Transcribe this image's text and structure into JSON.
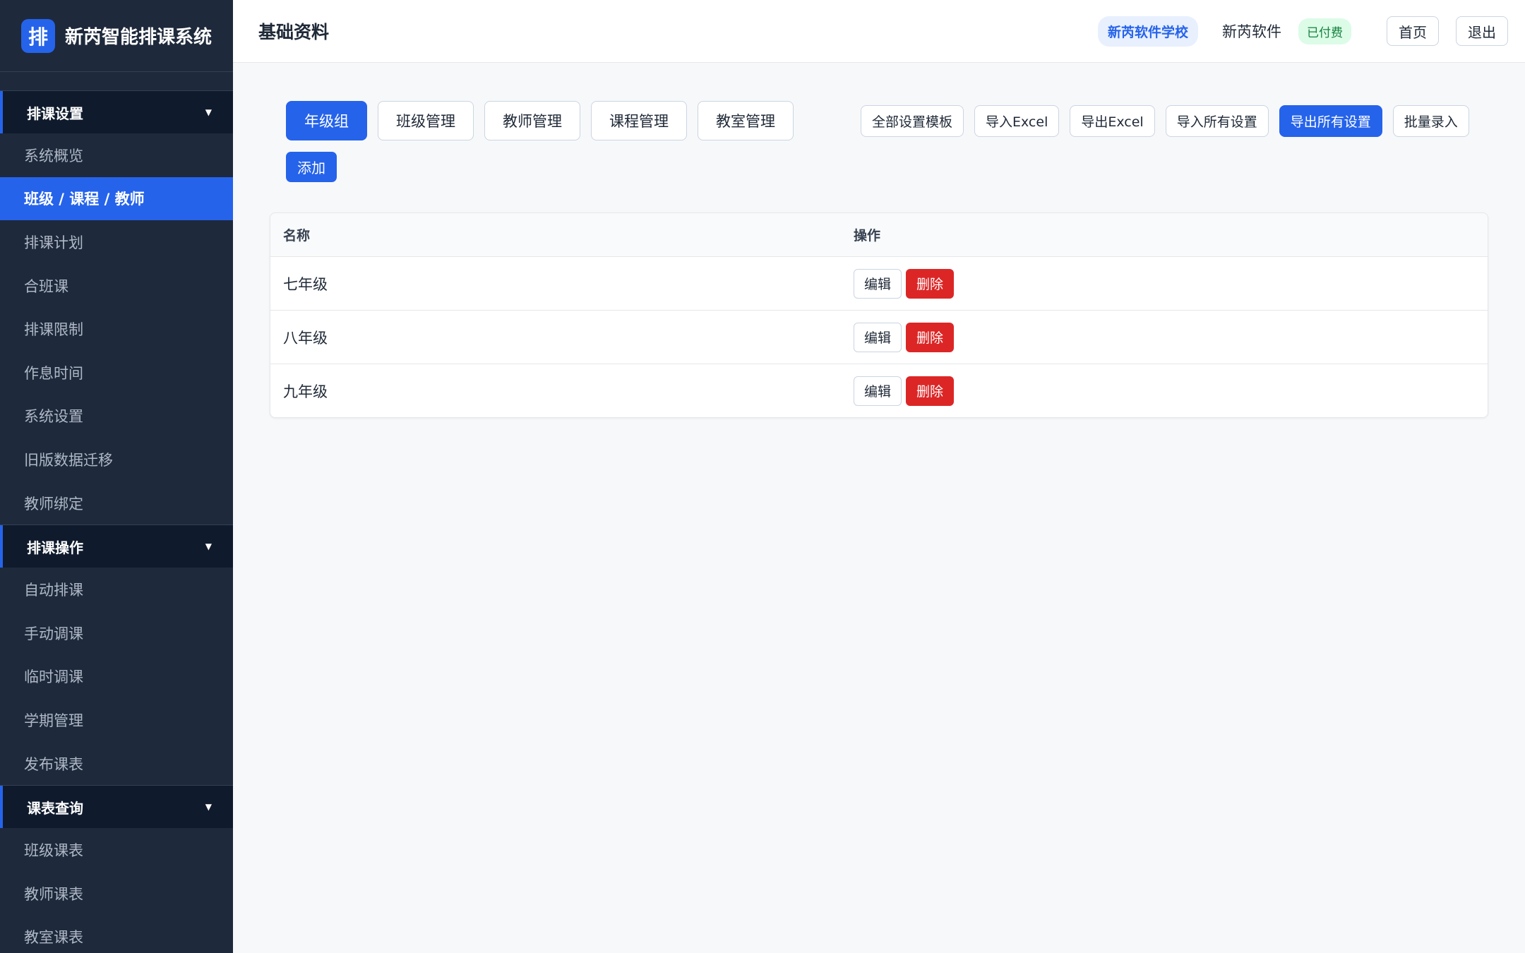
{
  "app": {
    "logo_char": "排",
    "title": "新芮智能排课系统"
  },
  "sidebar": {
    "sections": [
      {
        "label": "排课设置",
        "items": [
          "系统概览",
          "班级 / 课程 / 教师",
          "排课计划",
          "合班课",
          "排课限制",
          "作息时间",
          "系统设置",
          "旧版数据迁移",
          "教师绑定"
        ]
      },
      {
        "label": "排课操作",
        "items": [
          "自动排课",
          "手动调课",
          "临时调课",
          "学期管理",
          "发布课表"
        ]
      },
      {
        "label": "课表查询",
        "items": [
          "班级课表",
          "教师课表",
          "教室课表"
        ]
      }
    ],
    "active_item": "班级 / 课程 / 教师"
  },
  "header": {
    "page_title": "基础资料",
    "school": "新芮软件学校",
    "user": "新芮软件",
    "paid_status": "已付费",
    "home_label": "首页",
    "logout_label": "退出"
  },
  "tabs": {
    "items": [
      "年级组",
      "班级管理",
      "教师管理",
      "课程管理",
      "教室管理"
    ],
    "active": "年级组"
  },
  "actions": {
    "template": "全部设置模板",
    "import_excel": "导入Excel",
    "export_excel": "导出Excel",
    "import_all": "导入所有设置",
    "export_all": "导出所有设置",
    "batch": "批量录入"
  },
  "add_label": "添加",
  "table": {
    "headers": [
      "名称",
      "操作"
    ],
    "rows": [
      {
        "name": "七年级"
      },
      {
        "name": "八年级"
      },
      {
        "name": "九年级"
      }
    ],
    "edit_label": "编辑",
    "delete_label": "删除"
  },
  "colors": {
    "accent": "#2563eb",
    "sidebar_bg": "#1e293b",
    "danger": "#dc2626"
  }
}
